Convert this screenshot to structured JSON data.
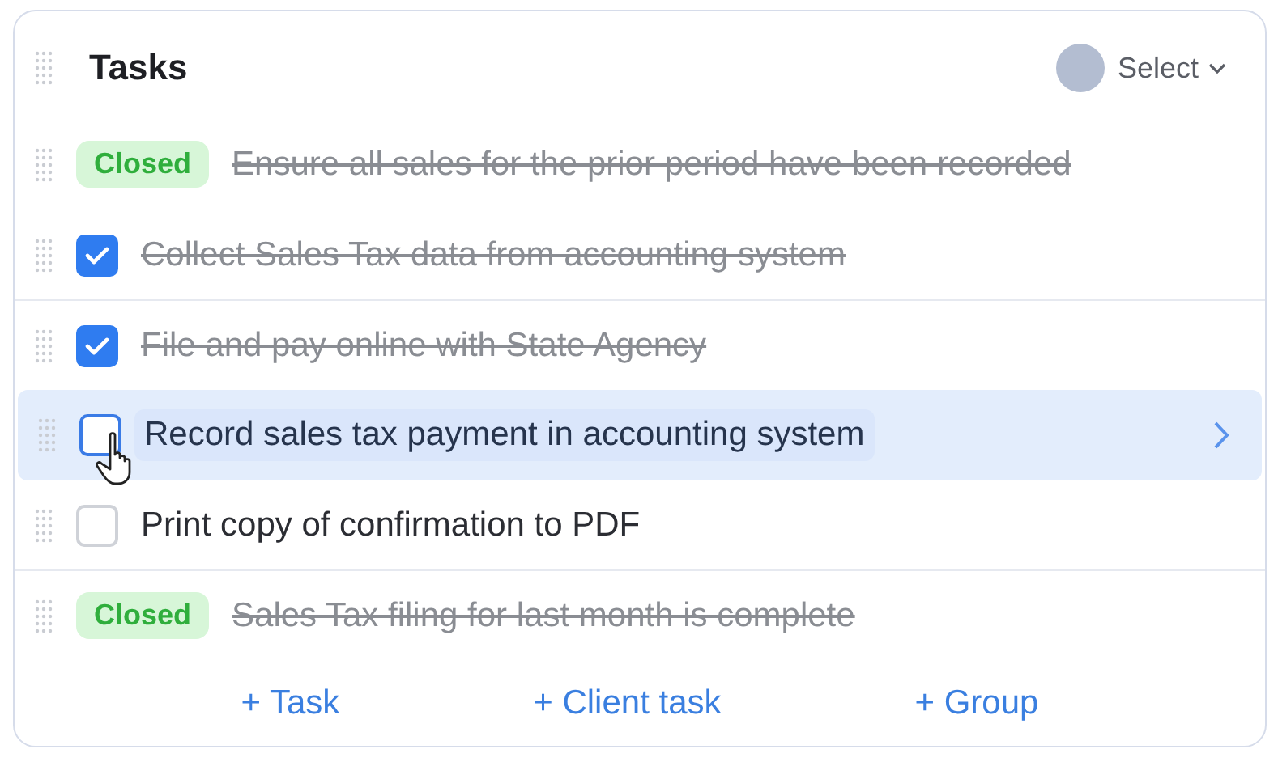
{
  "title": "Tasks",
  "assignee": {
    "label": "Select"
  },
  "rows": [
    {
      "kind": "closed",
      "badge": "Closed",
      "label": "Ensure all sales for the prior period have been recorded",
      "selected": false
    },
    {
      "kind": "checkbox",
      "checked": true,
      "label": "Collect Sales Tax data from accounting system",
      "selected": false
    },
    {
      "kind": "checkbox",
      "checked": true,
      "label": "File and pay online with State Agency",
      "selected": false
    },
    {
      "kind": "checkbox",
      "checked": false,
      "label": "Record sales tax payment in accounting system",
      "selected": true
    },
    {
      "kind": "checkbox",
      "checked": false,
      "label": "Print copy of confirmation to PDF",
      "selected": false
    },
    {
      "kind": "closed",
      "badge": "Closed",
      "label": "Sales Tax filing for last month is complete",
      "selected": false
    }
  ],
  "actions": [
    "+ Task",
    "+ Client task",
    "+ Group"
  ]
}
